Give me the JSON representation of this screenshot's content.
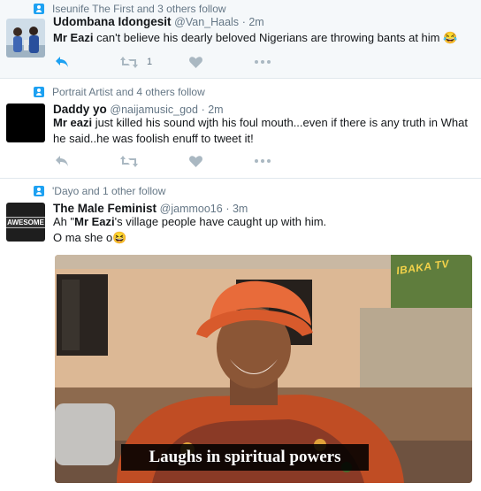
{
  "tweets": [
    {
      "context": "Iseunife The First and 3 others follow",
      "name": "Udombana Idongesit",
      "handle": "@Van_Haals",
      "time": "· 2m",
      "text_bold": "Mr Eazi",
      "text": " can't believe his dearly beloved Nigerians are throwing bants at him 😂",
      "retweet_count": "1"
    },
    {
      "context": "Portrait Artist and 4 others follow",
      "name": "Daddy yo",
      "handle": "@naijamusic_god",
      "time": "· 2m",
      "text_bold": "Mr eazi",
      "text": " just killed his sound wjth his foul mouth...even if there is any truth in What he said..he was foolish enuff to tweet it!",
      "retweet_count": ""
    },
    {
      "context": "'Dayo and 1 other follow",
      "name": "The Male Feminist",
      "handle": "@jammoo16",
      "time": "· 3m",
      "text_pre": "Ah \"",
      "text_bold": "Mr Eazi",
      "text": "'s village people have caught up with him.",
      "text_line2": "O ma she o😆",
      "avatar_text": "AWESOME",
      "media_caption": "Laughs in spiritual powers",
      "media_watermark": "IBAKA TV"
    }
  ],
  "icons": [
    "follow-context-icon",
    "reply-icon",
    "retweet-icon",
    "like-icon",
    "more-icon"
  ],
  "colors": {
    "accent": "#1da1f2",
    "muted": "#657786",
    "icon": "#aab8c2"
  }
}
